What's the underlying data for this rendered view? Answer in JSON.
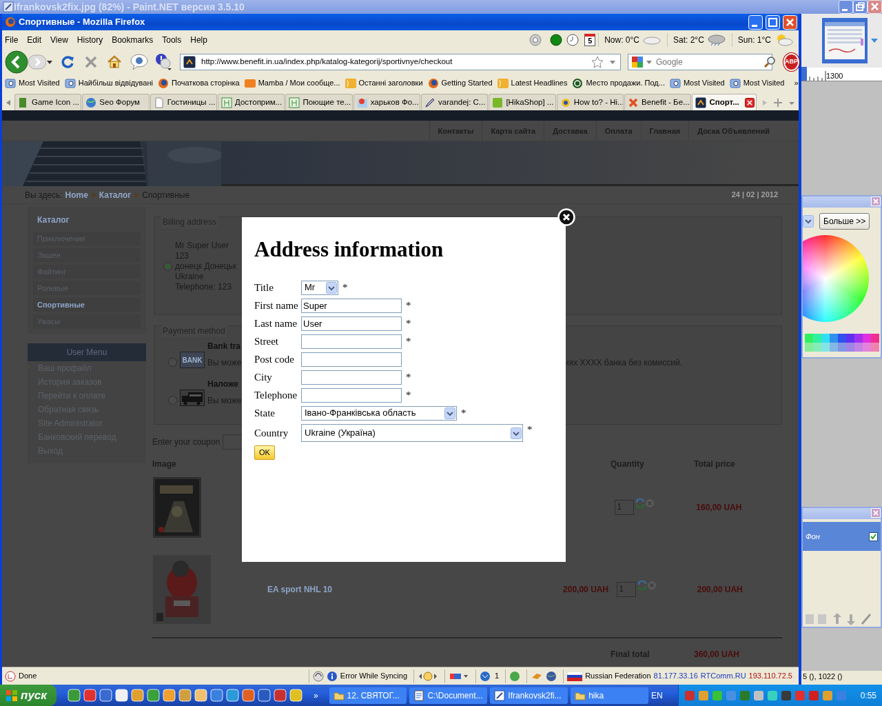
{
  "paint_window": {
    "title": "Ifrankovsk2fix.jpg (82%) - Paint.NET версия 3.5.10",
    "ruler_label": "1300",
    "colors_window": {
      "more_button": "Больше >>"
    },
    "layers_window": {
      "layers": [
        {
          "name": "Фон",
          "visible": true
        }
      ]
    },
    "status": "5 (), 1022 ()"
  },
  "browser": {
    "title": "Спортивные - Mozilla Firefox",
    "menu": [
      "File",
      "Edit",
      "View",
      "History",
      "Bookmarks",
      "Tools",
      "Help"
    ],
    "calendar_day": "5",
    "weather": [
      {
        "label": "Now: 0°C",
        "kind": "cloud"
      },
      {
        "label": "Sat: 2°C",
        "kind": "rain"
      },
      {
        "label": "Sun: 1°C",
        "kind": "sun"
      }
    ],
    "url": "http://www.benefit.in.ua/index.php/katalog-kategorij/sportivnye/checkout",
    "search": {
      "placeholder": "Google"
    },
    "adblock_label": "ABP",
    "bookmarks": [
      {
        "label": "Most Visited",
        "kind": "smart"
      },
      {
        "label": "Найбільш відвідувані",
        "kind": "smart"
      },
      {
        "label": "Початкова сторінка",
        "kind": "firefox"
      },
      {
        "label": "Mamba / Мои сообще...",
        "kind": "mamba"
      },
      {
        "label": "Останні заголовки",
        "kind": "rss"
      },
      {
        "label": "Getting Started",
        "kind": "firefox"
      },
      {
        "label": "Latest Headlines",
        "kind": "rss"
      },
      {
        "label": "Место продажи. Под...",
        "kind": "circle"
      },
      {
        "label": "Most Visited",
        "kind": "smart"
      },
      {
        "label": "Most Visited",
        "kind": "smart"
      }
    ],
    "bookmarks_more": "»",
    "tabs": [
      {
        "label": "Game Icon ...",
        "kind": "game",
        "selected": false
      },
      {
        "label": "Seo Форум",
        "kind": "globe",
        "selected": false
      },
      {
        "label": "Гостиницы ...",
        "kind": "page",
        "selected": false
      },
      {
        "label": "Достоприм...",
        "kind": "building",
        "selected": false
      },
      {
        "label": "Поющие те...",
        "kind": "building",
        "selected": false
      },
      {
        "label": "харьков Фо...",
        "kind": "map",
        "selected": false
      },
      {
        "label": "varandej: C...",
        "kind": "pencil",
        "selected": false
      },
      {
        "label": "[HikaShop] ...",
        "kind": "hika",
        "selected": false
      },
      {
        "label": "How to? - Hi...",
        "kind": "flower",
        "selected": false
      },
      {
        "label": "Benefit - Бе...",
        "kind": "joomla",
        "selected": false
      },
      {
        "label": "Спорт...",
        "kind": "site",
        "selected": true
      }
    ],
    "status_bar": {
      "left": "Done",
      "sync": "Error While Syncing",
      "count": "1",
      "country": "Russian Federation",
      "ip": "81.177.33.16",
      "isp": "RTComm.RU",
      "server_ip": "193.110.72.5"
    }
  },
  "page": {
    "nav": [
      "Контакты",
      "Карта сайта",
      "Доставка",
      "Оплата",
      "Главная",
      "Доска Объявлений"
    ],
    "breadcrumb": {
      "prefix": "Вы здесь:",
      "links": [
        "Home",
        "Каталог"
      ],
      "current": "Спортивные"
    },
    "date": "24 | 02 | 2012",
    "catalog": {
      "title": "Каталог",
      "items": [
        {
          "label": "Приключения",
          "selected": false
        },
        {
          "label": "Экшен",
          "selected": false
        },
        {
          "label": "Файтинг",
          "selected": false
        },
        {
          "label": "Ролевые",
          "selected": false
        },
        {
          "label": "Спортивные",
          "selected": true
        },
        {
          "label": "Ужасы",
          "selected": false
        }
      ]
    },
    "user_menu": {
      "title": "User Menu",
      "items": [
        "Ваш профайл",
        "История заказов",
        "Перейти к оплате",
        "Обратная связь",
        "Site Administrator",
        "Банковский перевод",
        "Выход"
      ]
    },
    "billing": {
      "legend": "Billing address",
      "selected": true,
      "lines": [
        "Mr Super User",
        "123",
        "донецк Донецьк",
        "Ukraine",
        "Telephone: 123"
      ]
    },
    "payment": {
      "legend": "Payment method",
      "methods": [
        {
          "kind": "bank",
          "icon_label": "BANK",
          "title": "Bank tra",
          "description": "Вы може",
          "selected": false
        },
        {
          "kind": "truck",
          "title": "Наложе",
          "description": "Вы може",
          "selected": false
        }
      ],
      "description_tail": "иях XXXX банка без комиссий."
    },
    "coupon_label": "Enter your coupon",
    "cart": {
      "columns": [
        "Image",
        "Quantity",
        "Total price"
      ],
      "rows": [
        {
          "quantity": "1",
          "total": "160,00 UAH"
        },
        {
          "name": "EA sport NHL 10",
          "price": "200,00 UAH",
          "quantity": "1",
          "total": "200,00 UAH"
        }
      ],
      "final_label": "Final total",
      "final_value": "360,00 UAH"
    }
  },
  "modal": {
    "title": "Address information",
    "required_mark": "*",
    "fields": [
      {
        "label": "Title",
        "kind": "select",
        "value": "Mr",
        "required": true
      },
      {
        "label": "First name",
        "kind": "text",
        "value": "Super",
        "required": true
      },
      {
        "label": "Last name",
        "kind": "text",
        "value": "User",
        "required": true
      },
      {
        "label": "Street",
        "kind": "text",
        "required": true
      },
      {
        "label": "Post code",
        "kind": "text",
        "required": false
      },
      {
        "label": "City",
        "kind": "text",
        "required": true
      },
      {
        "label": "Telephone",
        "kind": "text",
        "required": true
      },
      {
        "label": "State",
        "kind": "select",
        "value": "Івано-Франківська область",
        "required": true
      },
      {
        "label": "Country",
        "kind": "list",
        "value": "Ukraine (Україна)",
        "required": true
      }
    ],
    "ok_button": "OK"
  },
  "taskbar": {
    "start": "пуск",
    "more": "»",
    "tasks": [
      {
        "label": "12. СВЯТОГ...",
        "kind": "folder"
      },
      {
        "label": "C:\\Document...",
        "kind": "notepad"
      },
      {
        "label": "Ifrankovsk2fi...",
        "kind": "paint"
      },
      {
        "label": "hika",
        "kind": "folder"
      }
    ],
    "language": "EN",
    "clock": "0:55"
  }
}
